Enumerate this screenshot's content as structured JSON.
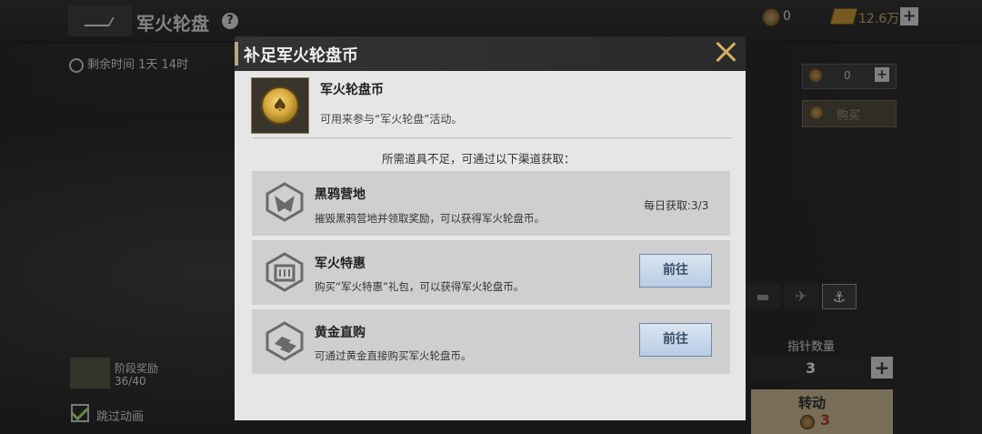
{
  "background": {
    "page_title": "军火轮盘",
    "help_icon": "?",
    "coin_count": "0",
    "gold_count": "12.6万",
    "plus_label": "+",
    "timer_text": "剩余时间 1天 14时",
    "right_panel": {
      "qty_value": "0",
      "buy_label": "购买"
    },
    "tabs": [
      "▬",
      "✈",
      "⚓"
    ],
    "pointer_label": "指针数量",
    "pointer_value": "3",
    "spin_label": "转动",
    "spin_cost": "3",
    "stage_label": "阶段奖励",
    "stage_count": "36/40",
    "skip_label": "跳过动画"
  },
  "modal": {
    "title": "补足军火轮盘币",
    "item": {
      "name": "军火轮盘币",
      "description": "可用来参与“军火轮盘”活动。"
    },
    "notice": "所需道具不足，可通过以下渠道获取：",
    "sources": [
      {
        "title": "黑鸦营地",
        "description": "摧毁黑鸦营地并领取奖励，可以获得军火轮盘币。",
        "daily": "每日获取:3/3",
        "icon": "black-crow-camp-icon"
      },
      {
        "title": "军火特惠",
        "description": "购买“军火特惠”礼包，可以获得军火轮盘币。",
        "button": "前往",
        "icon": "arms-deal-icon"
      },
      {
        "title": "黄金直购",
        "description": "可通过黄金直接购买军火轮盘币。",
        "button": "前往",
        "icon": "gold-bars-icon"
      }
    ]
  },
  "colors": {
    "accent": "#b8a886",
    "close": "#d8b060",
    "go_button": "#b8cde6"
  }
}
